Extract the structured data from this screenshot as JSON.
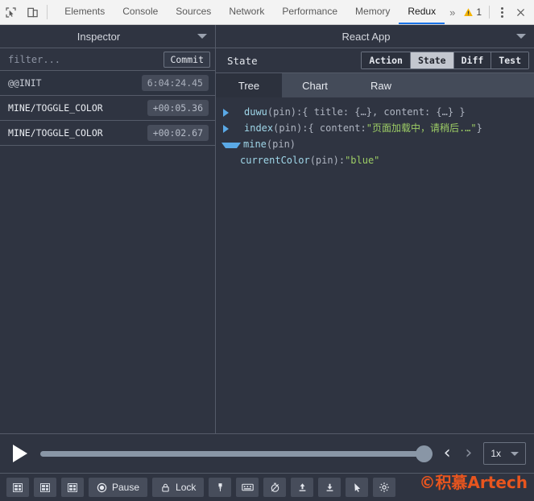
{
  "devtools": {
    "icons": {
      "inspect": "inspect-element-icon",
      "device": "device-toolbar-icon",
      "more_tabs": "chevron-double-right-icon",
      "warning": "warning-triangle-icon",
      "kebab": "kebab-menu-icon",
      "close": "close-icon"
    },
    "tabs": [
      {
        "label": "Elements",
        "active": false
      },
      {
        "label": "Console",
        "active": false
      },
      {
        "label": "Sources",
        "active": false
      },
      {
        "label": "Network",
        "active": false
      },
      {
        "label": "Performance",
        "active": false
      },
      {
        "label": "Memory",
        "active": false
      },
      {
        "label": "Redux",
        "active": true
      }
    ],
    "more_tabs_glyph": "»",
    "warning_count": "1",
    "close_glyph": "✕",
    "accent_color": "#1a73e8",
    "warning_color": "#f5b400"
  },
  "left_pane": {
    "title": "Inspector",
    "dropdown_icon": "chevron-down-icon",
    "filter": {
      "value": "",
      "placeholder": "filter..."
    },
    "commit_label": "Commit",
    "actions": [
      {
        "name": "@@INIT",
        "time": "6:04:24.45",
        "selected": true
      },
      {
        "name": "MINE/TOGGLE_COLOR",
        "time": "+00:05.36",
        "selected": false
      },
      {
        "name": "MINE/TOGGLE_COLOR",
        "time": "+00:02.67",
        "selected": false
      }
    ]
  },
  "right_pane": {
    "title": "React App",
    "dropdown_icon": "chevron-down-icon",
    "state_label": "State",
    "view_buttons": [
      {
        "label": "Action",
        "active": false
      },
      {
        "label": "State",
        "active": true
      },
      {
        "label": "Diff",
        "active": false
      },
      {
        "label": "Test",
        "active": false
      }
    ],
    "subtabs": [
      {
        "label": "Tree",
        "active": true
      },
      {
        "label": "Chart",
        "active": false
      },
      {
        "label": "Raw",
        "active": false
      }
    ],
    "tree": [
      {
        "expanded": false,
        "key": "duwu",
        "pin": " (pin): ",
        "value": "{ title: {…}, content: {…} }",
        "value_type": "dim",
        "child": false
      },
      {
        "expanded": false,
        "key": "index",
        "pin": " (pin): ",
        "value_prefix": "{ content: ",
        "value_string": "\"页面加载中，请稍后.…\"",
        "value_suffix": " }",
        "value_type": "mixed",
        "child": false
      },
      {
        "expanded": true,
        "key": "mine",
        "pin": " (pin)",
        "value": "",
        "value_type": "dim",
        "child": false
      },
      {
        "expanded": null,
        "key": "currentColor",
        "pin": " (pin): ",
        "value": "\"blue\"",
        "value_type": "string",
        "child": true
      }
    ]
  },
  "slider_bar": {
    "play_icon": "play-icon",
    "slider_value": 100,
    "prev_icon": "chevron-left-icon",
    "next_icon": "chevron-right-icon",
    "prev_glyph": "‹",
    "next_glyph": "›",
    "speed_label": "1x",
    "speed_caret_icon": "chevron-down-icon"
  },
  "bottom_bar": {
    "buttons": [
      {
        "id": "layout-vertical",
        "icon": "grid-layout-icon",
        "label": "",
        "icon_only": true
      },
      {
        "id": "layout-horizontal",
        "icon": "grid-layout-icon",
        "label": "",
        "icon_only": true
      },
      {
        "id": "layout-auto",
        "icon": "grid-layout-icon",
        "label": "",
        "icon_only": true
      },
      {
        "id": "pause",
        "icon": "record-circle-icon",
        "label": "Pause",
        "icon_only": false
      },
      {
        "id": "lock",
        "icon": "lock-icon",
        "label": "Lock",
        "icon_only": false
      },
      {
        "id": "persist",
        "icon": "pin-icon",
        "label": "",
        "icon_only": true
      },
      {
        "id": "dispatcher",
        "icon": "keyboard-icon",
        "label": "",
        "icon_only": true
      },
      {
        "id": "slider-toggle",
        "icon": "no-stopwatch-icon",
        "label": "",
        "icon_only": true
      },
      {
        "id": "import",
        "icon": "upload-icon",
        "label": "",
        "icon_only": true
      },
      {
        "id": "export",
        "icon": "download-icon",
        "label": "",
        "icon_only": true
      },
      {
        "id": "print",
        "icon": "cursor-icon",
        "label": "",
        "icon_only": true
      },
      {
        "id": "settings",
        "icon": "gear-icon",
        "label": "",
        "icon_only": true
      }
    ]
  },
  "watermark": {
    "text": "©积慕Artech",
    "color": "#e8551e"
  }
}
